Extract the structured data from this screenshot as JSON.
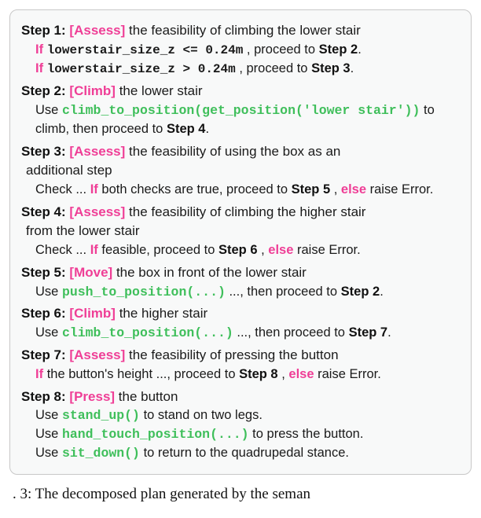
{
  "step1": {
    "head_num": "Step 1:",
    "head_action": "[Assess]",
    "head_rest": " the feasibility of climbing the lower stair",
    "line_a_if": "If",
    "line_a_code": " lowerstair_size_z <= 0.24m",
    "line_a_rest": ", proceed to ",
    "line_a_target": "Step 2",
    "line_b_if": "If",
    "line_b_code": " lowerstair_size_z  > 0.24m",
    "line_b_rest": ", proceed to ",
    "line_b_target": "Step 3"
  },
  "step2": {
    "head_num": "Step 2:",
    "head_action": "[Climb]",
    "head_rest": " the lower stair",
    "body_a": "Use ",
    "body_fn": "climb_to_position(get_position('lower stair'))",
    "body_b": " to climb, then proceed to ",
    "body_target": "Step 4"
  },
  "step3": {
    "head_num": "Step 3:",
    "head_action": "[Assess]",
    "head_rest_a": " the feasibility of using the box as an",
    "head_rest_b": "additional step",
    "body_a": "Check ... ",
    "body_if": "If",
    "body_b": " both checks are true, proceed to ",
    "body_target": "Step 5",
    "body_c": ", ",
    "body_else": "else",
    "body_d": " raise Error."
  },
  "step4": {
    "head_num": "Step 4:",
    "head_action": "[Assess]",
    "head_rest_a": " the feasibility of climbing the higher stair",
    "head_rest_b": "from the lower stair",
    "body_a": "Check ... ",
    "body_if": "If",
    "body_b": " feasible, proceed to ",
    "body_target": "Step 6",
    "body_c": ", ",
    "body_else": "else",
    "body_d": " raise Error."
  },
  "step5": {
    "head_num": "Step 5:",
    "head_action": "[Move]",
    "head_rest": " the box in front of the lower stair",
    "body_a": "Use ",
    "body_fn": "push_to_position(...)",
    "body_b": " ..., then proceed to ",
    "body_target": "Step 2"
  },
  "step6": {
    "head_num": "Step 6:",
    "head_action": "[Climb]",
    "head_rest": " the higher stair",
    "body_a": "Use ",
    "body_fn": "climb_to_position(...)",
    "body_b": " ..., then proceed to ",
    "body_target": "Step 7"
  },
  "step7": {
    "head_num": "Step 7:",
    "head_action": "[Assess]",
    "head_rest": " the feasibility of pressing the button",
    "body_if": "If",
    "body_a": " the button's height ..., proceed to ",
    "body_target": "Step 8",
    "body_b": ",  ",
    "body_else": "else",
    "body_c": " raise Error."
  },
  "step8": {
    "head_num": "Step 8:",
    "head_action": "[Press]",
    "head_rest": " the button",
    "l1_a": "Use ",
    "l1_fn": "stand_up()",
    "l1_b": " to stand on two legs.",
    "l2_a": "Use ",
    "l2_fn": "hand_touch_position(...)",
    "l2_b": " to press the button.",
    "l3_a": "Use ",
    "l3_fn": "sit_down()",
    "l3_b": " to return to the quadrupedal stance."
  },
  "caption": ". 3: The decomposed plan generated by the seman"
}
